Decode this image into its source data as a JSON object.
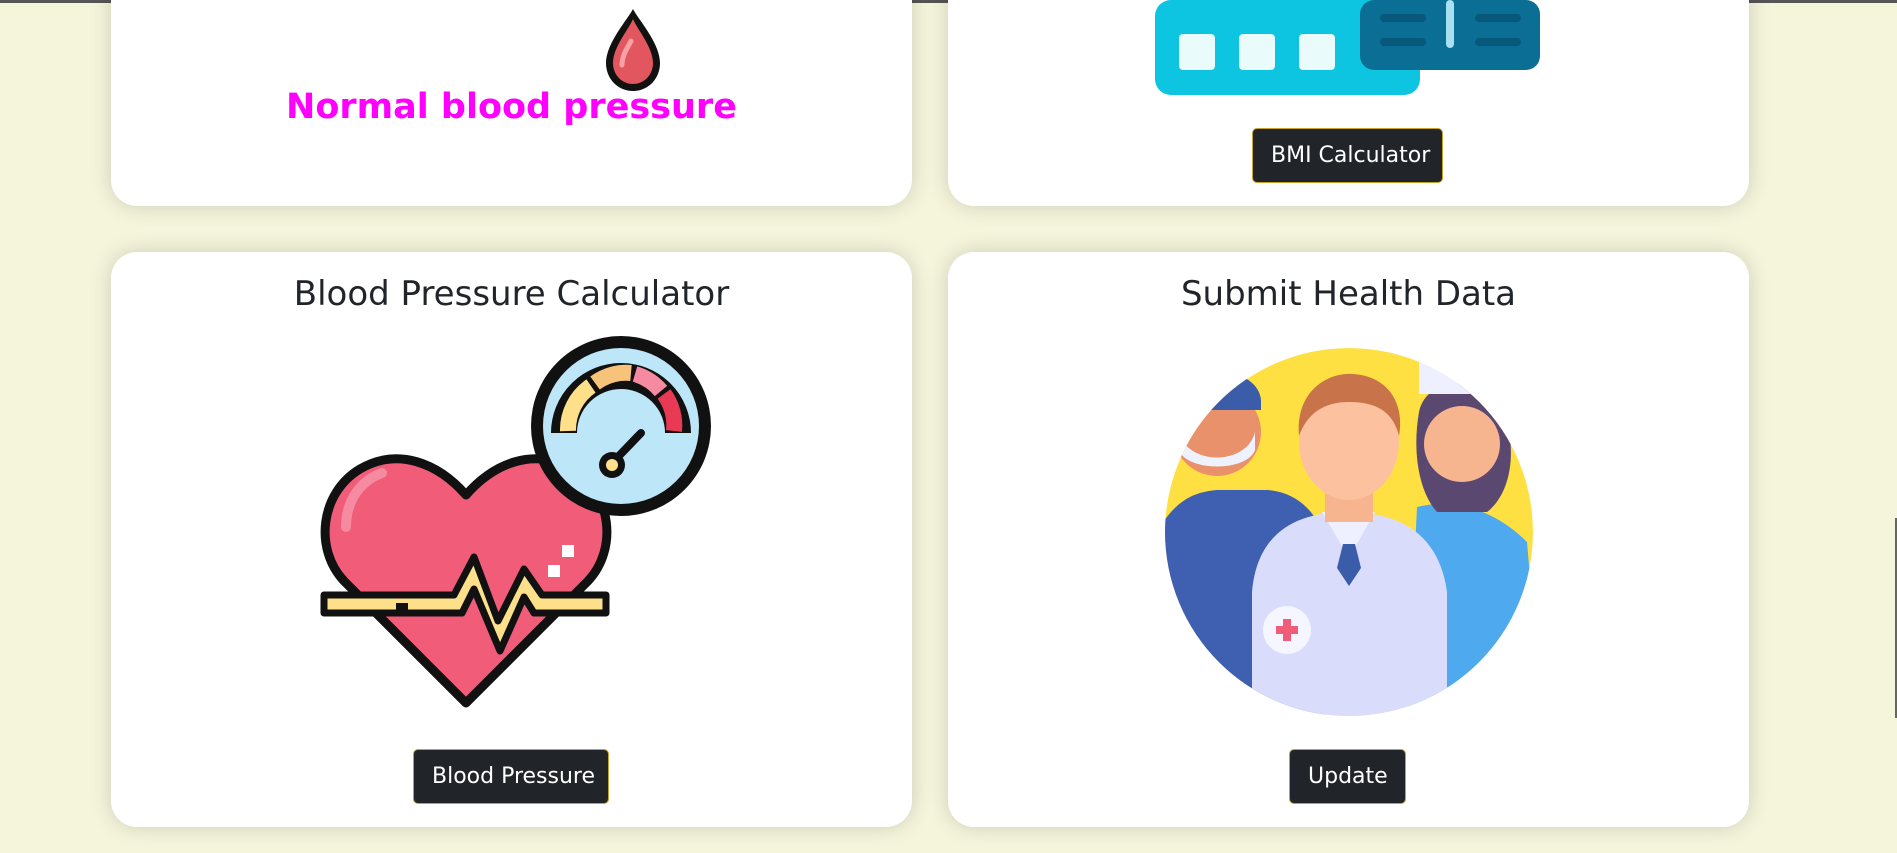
{
  "cards": {
    "bp_status": {
      "status_text": "Normal blood pressure",
      "status_color": "#ff00ff",
      "icon": "blood-drop-icon"
    },
    "bmi": {
      "button_label": "BMI Calculator",
      "icon": "scale-icon"
    },
    "bp_calculator": {
      "title": "Blood Pressure Calculator",
      "button_label": "Blood Pressure",
      "icon": "heart-gauge-icon"
    },
    "health_data": {
      "title": "Submit Health Data",
      "button_label": "Update",
      "icon": "medical-team-icon"
    }
  },
  "colors": {
    "page_background": "#f5f5dc",
    "button_background": "#212529",
    "button_border": "#c9a227"
  }
}
